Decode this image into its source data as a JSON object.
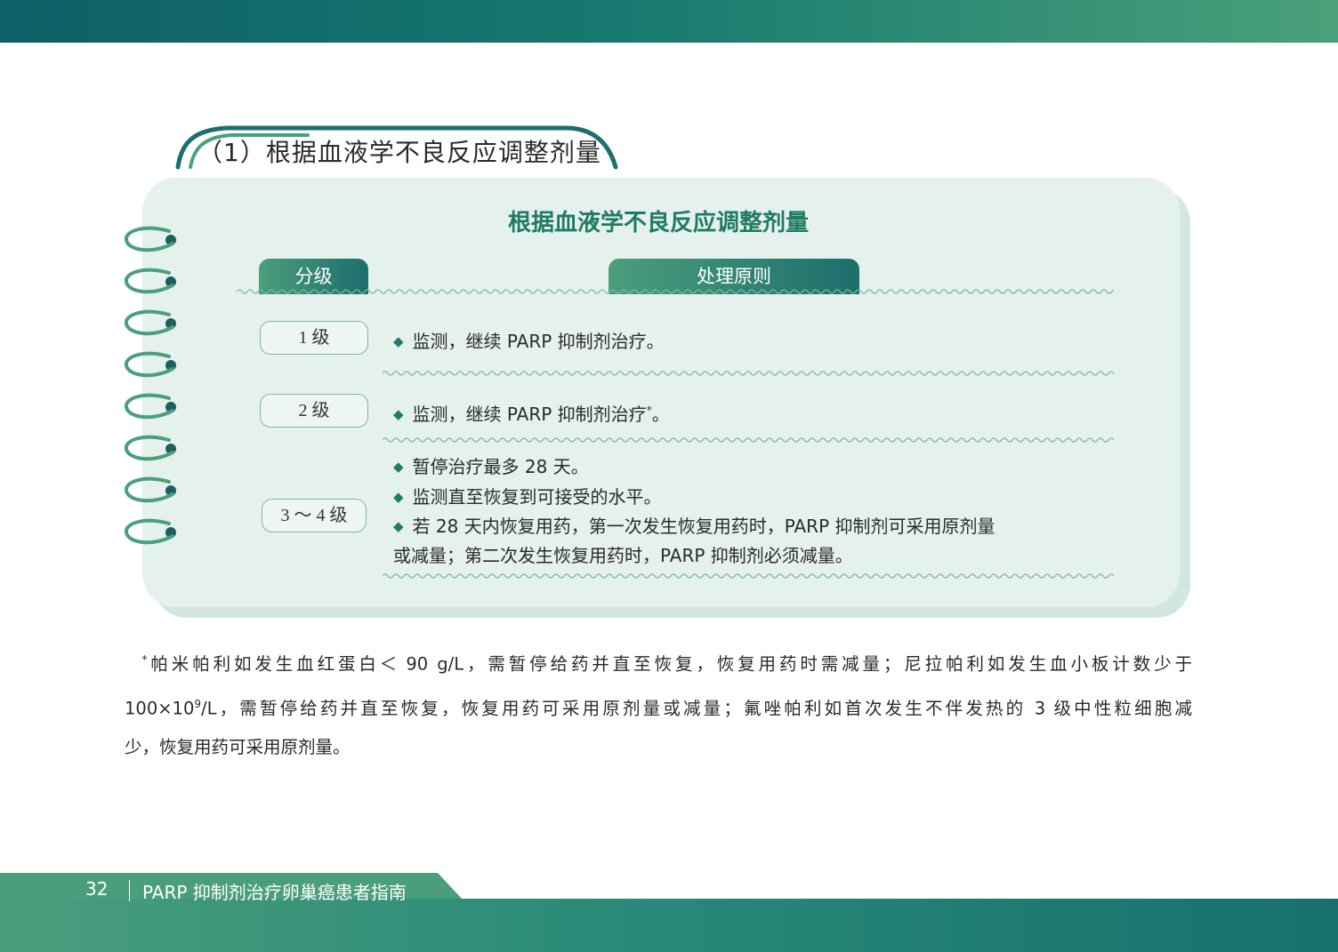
{
  "section": {
    "title": "（1）根据血液学不良反应调整剂量"
  },
  "table": {
    "title": "根据血液学不良反应调整剂量",
    "header_grade": "分级",
    "header_principle": "处理原则",
    "rows": [
      {
        "grade": "1 级",
        "lines": [
          {
            "text": "监测，继续 PARP 抑制剂治疗。"
          }
        ]
      },
      {
        "grade": "2 级",
        "lines": [
          {
            "text": "监测，继续 PARP 抑制剂治疗",
            "sup": "*",
            "tail": "。"
          }
        ]
      },
      {
        "grade": "3 ～ 4 级",
        "lines": [
          {
            "text": "暂停治疗最多 28 天。"
          },
          {
            "text": "监测直至恢复到可接受的水平。"
          },
          {
            "text": "若 28 天内恢复用药，第一次发生恢复用药时，PARP 抑制剂可采用原剂量"
          },
          {
            "text": "或减量；第二次发生恢复用药时，PARP 抑制剂必须减量。"
          }
        ]
      }
    ]
  },
  "footnote": {
    "mark": "*",
    "line1": "帕米帕利如发生血红蛋白＜ 90 g/L，需暂停给药并直至恢复，恢复用药时需减量；尼拉帕利如发生血小板计数少于",
    "line2_a": "100×10",
    "line2_sup": "9",
    "line2_b": "/L，需暂停给药并直至恢复，恢复用药可采用原剂量或减量；氟唑帕利如首次发生不伴发热的 3 级中性粒细胞减",
    "line3": "少，恢复用药可采用原剂量。"
  },
  "footer": {
    "page_number": "32",
    "title": "PARP 抑制剂治疗卵巢癌患者指南"
  },
  "colors": {
    "primary": "#1f7a66",
    "card_bg": "#e5f1ec",
    "header_dark": "#0f5f68",
    "accent_light": "#4aa07a"
  }
}
